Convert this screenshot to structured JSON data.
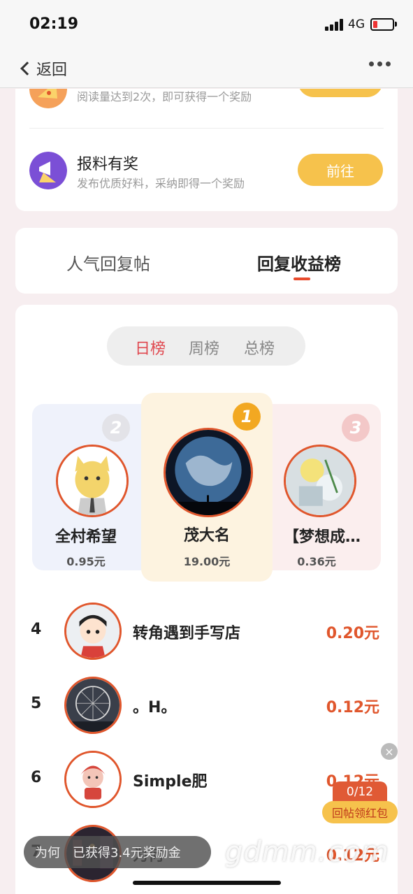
{
  "status_bar": {
    "time": "02:19",
    "network": "4G"
  },
  "nav": {
    "back_label": "返回"
  },
  "tasks": [
    {
      "title": "",
      "desc": "阅读量达到2次，即可获得一个奖励",
      "button": "前往"
    },
    {
      "title": "报料有奖",
      "desc": "发布优质好料，采纳即得一个奖励",
      "button": "前往"
    }
  ],
  "tabs": {
    "popular": "人气回复帖",
    "income": "回复收益榜"
  },
  "periods": {
    "day": "日榜",
    "week": "周榜",
    "total": "总榜"
  },
  "podium": {
    "first": {
      "rank": "1",
      "name": "茂大名",
      "amount": "19.00元"
    },
    "second": {
      "rank": "2",
      "name": "全村希望",
      "amount": "0.95元"
    },
    "third": {
      "rank": "3",
      "name": "【梦想成…",
      "amount": "0.36元"
    }
  },
  "list": [
    {
      "rank": "4",
      "name": "转角遇到手写店",
      "amount": "0.20元"
    },
    {
      "rank": "5",
      "name": "。H。",
      "amount": "0.12元"
    },
    {
      "rank": "6",
      "name": "Simple肥",
      "amount": "0.12元"
    },
    {
      "rank": "7",
      "name": "为何",
      "amount": "0.12元"
    }
  ],
  "red_packet": {
    "counter": "0/12",
    "label": "回帖领红包",
    "close": "×"
  },
  "toast": {
    "user": "为何",
    "text": "已获得3.4元奖励金"
  },
  "watermark": "gdmm.com",
  "colors": {
    "accent": "#e0562c",
    "button": "#f6c24c",
    "active_period": "#e0474e"
  }
}
